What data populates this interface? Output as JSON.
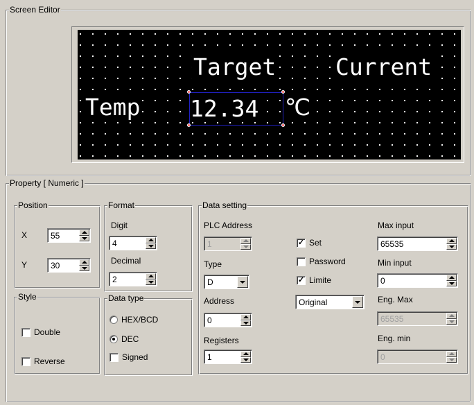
{
  "screen_editor": {
    "title": "Screen Editor",
    "lcd": {
      "target_label": "Target",
      "current_label": "Current",
      "temp_label": "Temp",
      "value": "12.34",
      "unit": "℃"
    }
  },
  "property": {
    "title": "Property [ Numeric ]",
    "position": {
      "title": "Position",
      "x_label": "X",
      "x_value": "55",
      "y_label": "Y",
      "y_value": "30"
    },
    "format": {
      "title": "Format",
      "digit_label": "Digit",
      "digit_value": "4",
      "decimal_label": "Decimal",
      "decimal_value": "2"
    },
    "style": {
      "title": "Style",
      "double_label": "Double",
      "double_checked": false,
      "reverse_label": "Reverse",
      "reverse_checked": false
    },
    "data_type": {
      "title": "Data type",
      "hex_label": "HEX/BCD",
      "dec_label": "DEC",
      "selected": "DEC",
      "signed_label": "Signed",
      "signed_checked": false
    },
    "data_setting": {
      "title": "Data setting",
      "plc_address_label": "PLC Address",
      "plc_address_value": "1",
      "type_label": "Type",
      "type_value": "D",
      "address_label": "Address",
      "address_value": "0",
      "registers_label": "Registers",
      "registers_value": "1",
      "set_label": "Set",
      "set_checked": true,
      "password_label": "Password",
      "password_checked": false,
      "limite_label": "Limite",
      "limite_checked": true,
      "mode_value": "Original",
      "max_input_label": "Max input",
      "max_input_value": "65535",
      "min_input_label": "Min input",
      "min_input_value": "0",
      "eng_max_label": "Eng. Max",
      "eng_max_value": "65535",
      "eng_min_label": "Eng. min",
      "eng_min_value": "0"
    }
  }
}
